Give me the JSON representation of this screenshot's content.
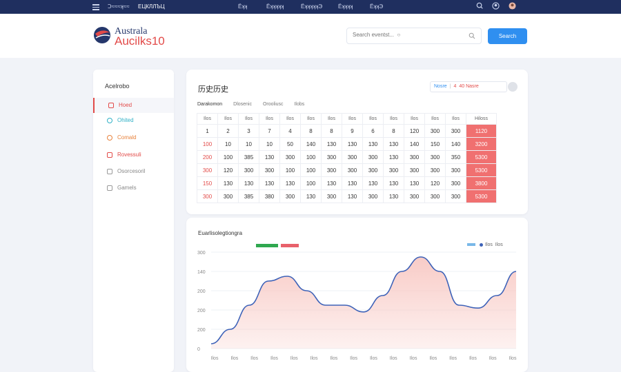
{
  "topnav": {
    "left_text": "Ↄ≈≈≈ʞ≈≈",
    "brand": "ЕЦКЛЛЪЦ",
    "links": [
      "Ёʞʞ",
      "Ёʞʞʞʞʞ",
      "ЁʞʞʞʞʞЭ",
      "Ёʞʞʞʞ",
      "ЁʞʞЭ"
    ],
    "icons": [
      "search-icon",
      "user-icon",
      "avatar-icon"
    ]
  },
  "header": {
    "logo_line1": "Australa",
    "logo_line2": "Aucilks10",
    "search_placeholder": "Search eventst...  ○",
    "button_label": "Search"
  },
  "sidebar": {
    "title": "Acelrobo",
    "items": [
      {
        "label": "Hoed",
        "icon": "home-icon",
        "color": "#e24a48"
      },
      {
        "label": "Ohited",
        "icon": "chart-icon",
        "color": "#2fb0c6"
      },
      {
        "label": "Comald",
        "icon": "calendar-icon",
        "color": "#e8823c"
      },
      {
        "label": "Rovessuli",
        "icon": "results-icon",
        "color": "#e24a48"
      },
      {
        "label": "Osorcesoril",
        "icon": "document-icon",
        "color": "#888888"
      },
      {
        "label": "Gamels",
        "icon": "settings-icon",
        "color": "#888888"
      }
    ]
  },
  "table_card": {
    "title": "历史历史",
    "filter_text_a": "Nosre",
    "filter_text_b": "4",
    "filter_text_c": "40",
    "filter_text_d": "Nasre",
    "subtabs": [
      "Darakomon",
      "Dlosenic",
      "Orooliusc",
      "Ilobs"
    ],
    "headers": [
      "Ilos",
      "Ilos",
      "Ilos",
      "Ilos",
      "Ilos",
      "Ilos",
      "Ilos",
      "Ilos",
      "Ilos",
      "Ilos",
      "Ilos",
      "Ilos",
      "Ilos",
      "Hiloss"
    ],
    "rows": [
      [
        "1",
        "2",
        "3",
        "7",
        "4",
        "8",
        "8",
        "9",
        "6",
        "8",
        "120",
        "300",
        "300",
        "1120"
      ],
      [
        "100",
        "10",
        "10",
        "10",
        "50",
        "140",
        "130",
        "130",
        "130",
        "130",
        "140",
        "150",
        "140",
        "3200"
      ],
      [
        "200",
        "100",
        "385",
        "130",
        "300",
        "100",
        "300",
        "300",
        "300",
        "130",
        "300",
        "300",
        "350",
        "5300"
      ],
      [
        "300",
        "120",
        "300",
        "300",
        "100",
        "100",
        "300",
        "300",
        "300",
        "300",
        "300",
        "300",
        "300",
        "5300"
      ],
      [
        "150",
        "130",
        "130",
        "130",
        "130",
        "100",
        "130",
        "130",
        "130",
        "130",
        "130",
        "120",
        "300",
        "3800"
      ],
      [
        "300",
        "300",
        "385",
        "380",
        "300",
        "130",
        "300",
        "130",
        "300",
        "130",
        "300",
        "300",
        "300",
        "5300"
      ]
    ],
    "red_first_column": true
  },
  "chart_card": {
    "title": "Euarlisolegtiongra",
    "legend_right_a": "Ilos",
    "legend_right_b": "Ilos",
    "chart_data": {
      "type": "area",
      "yticks": [
        "300",
        "140",
        "200",
        "200",
        "200",
        "0"
      ],
      "xticks": [
        "Ilos",
        "Ilos",
        "Ilos",
        "Ilos",
        "Ilos",
        "Ilos",
        "Ilos",
        "Ilos",
        "Ilos",
        "Ilos",
        "Ilos",
        "Ilos",
        "Ilos",
        "Ilos",
        "Ilos",
        "Ilos"
      ],
      "values": [
        5,
        20,
        45,
        70,
        75,
        60,
        45,
        45,
        38,
        55,
        80,
        95,
        80,
        45,
        42,
        55,
        80
      ],
      "ylim": [
        0,
        100
      ],
      "line_color": "#3d62b8",
      "fill_color": "#f8c9c4"
    }
  }
}
